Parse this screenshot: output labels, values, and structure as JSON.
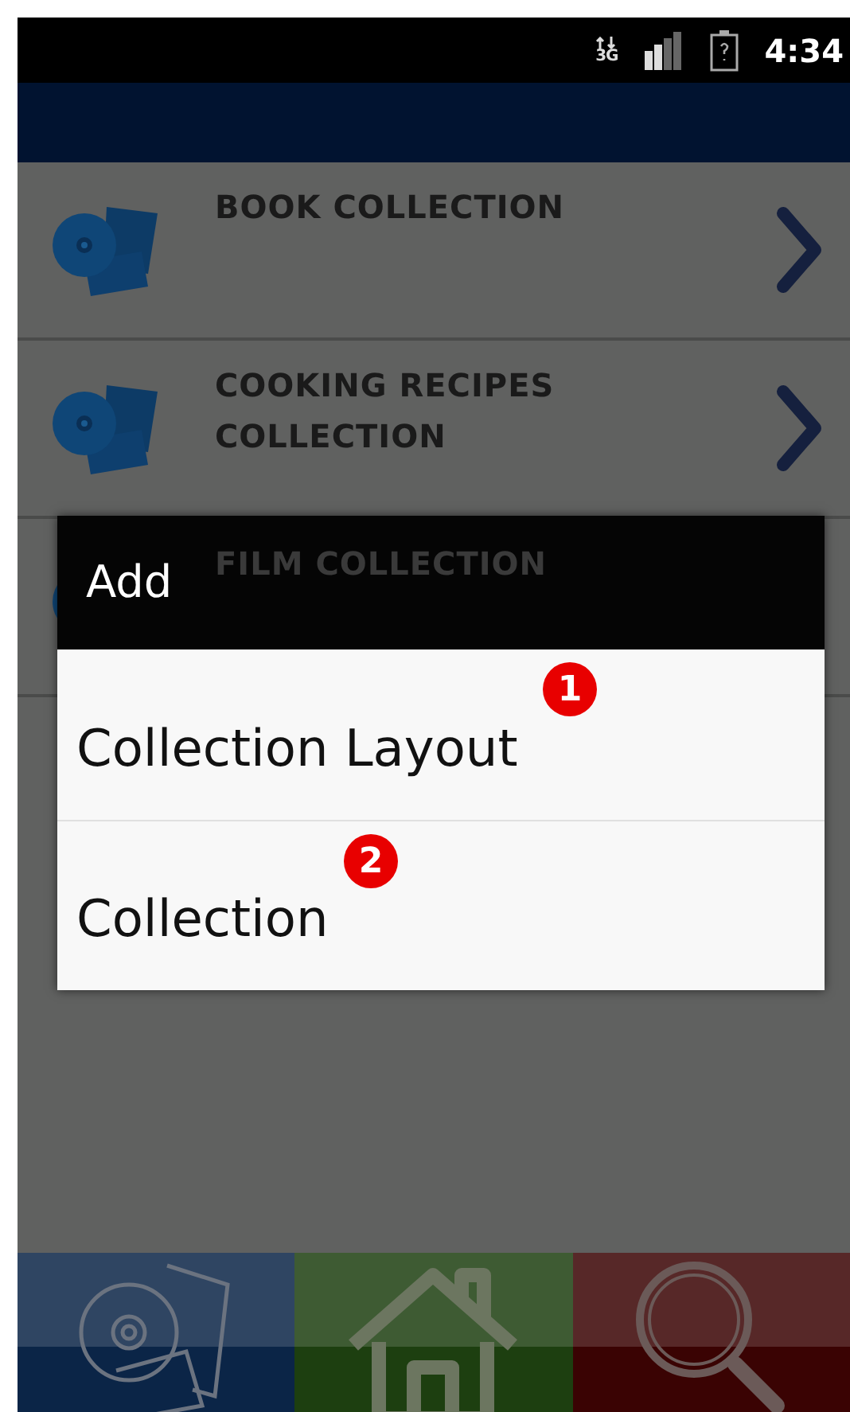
{
  "status_bar": {
    "network": "3G",
    "time": "4:34"
  },
  "collections": [
    {
      "title": "BOOK COLLECTION"
    },
    {
      "title": "COOKING RECIPES COLLECTION"
    },
    {
      "title": "FILM COLLECTION"
    }
  ],
  "dialog": {
    "title": "Add",
    "items": [
      {
        "label": "Collection Layout",
        "badge": "1"
      },
      {
        "label": "Collection",
        "badge": "2"
      }
    ]
  },
  "bottom_nav": [
    {
      "kind": "collections",
      "color": "#0b2547"
    },
    {
      "kind": "home",
      "color": "#1d3f10"
    },
    {
      "kind": "search",
      "color": "#3a0303"
    }
  ]
}
